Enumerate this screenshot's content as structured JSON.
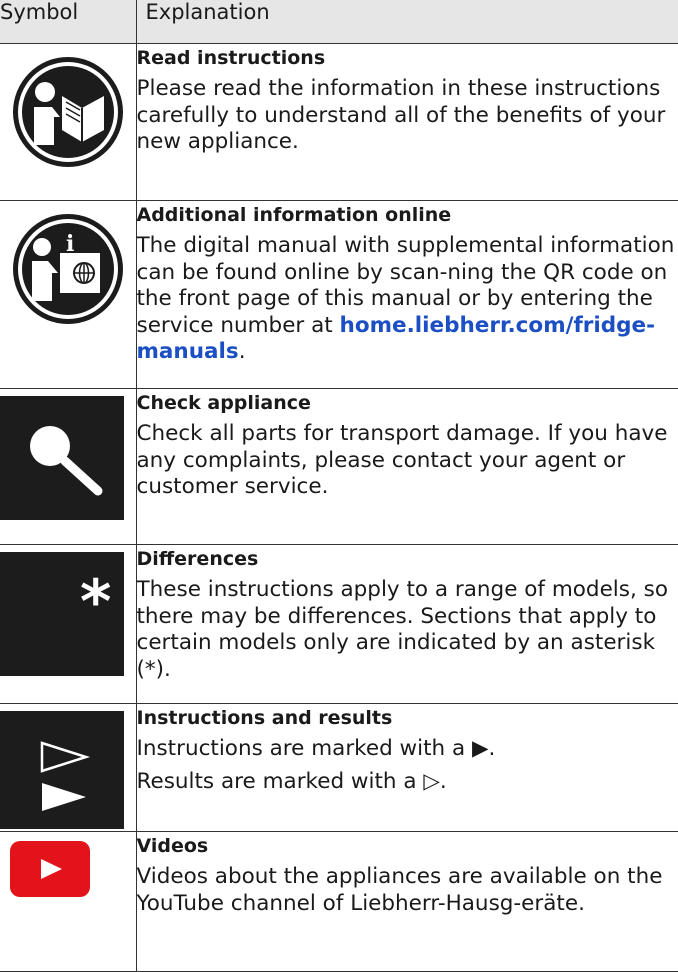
{
  "header": {
    "symbol": "Symbol",
    "explanation": "Explanation"
  },
  "rows": [
    {
      "icon": "read-instructions-icon",
      "title": "Read instructions",
      "text": "Please read the information in these instructions carefully to understand all of the benefits of your new appliance."
    },
    {
      "icon": "additional-information-online-icon",
      "title": "Additional information online",
      "text_before_link": "The digital manual with supplemental information can be found online by scan-ning the QR code on the front page of this manual or by entering the service number at ",
      "link": "home.liebherr.com/fridge-manuals",
      "text_after_link": "."
    },
    {
      "icon": "magnifier-icon",
      "title": "Check appliance",
      "text": "Check all parts for transport damage. If you have any complaints, please contact your agent or customer service."
    },
    {
      "icon": "asterisk-icon",
      "title": "Differences",
      "text": "These instructions apply to a range of models, so there may be differences. Sections that apply to certain models only are indicated by an asterisk (*)."
    },
    {
      "icon": "instruction-result-arrows-icon",
      "title": "Instructions and results",
      "line1": "Instructions are marked with a ▶.",
      "line2": "Results are marked with a ▷."
    },
    {
      "icon": "youtube-icon",
      "title": "Videos",
      "text": "Videos about the appliances are available on the YouTube channel of Liebherr-Hausg-eräte."
    }
  ],
  "colors": {
    "header_bg": "#e6e6e6",
    "link": "#1c4fc4",
    "youtube_red": "#e3131b",
    "icon_dark": "#1c1c1c"
  }
}
